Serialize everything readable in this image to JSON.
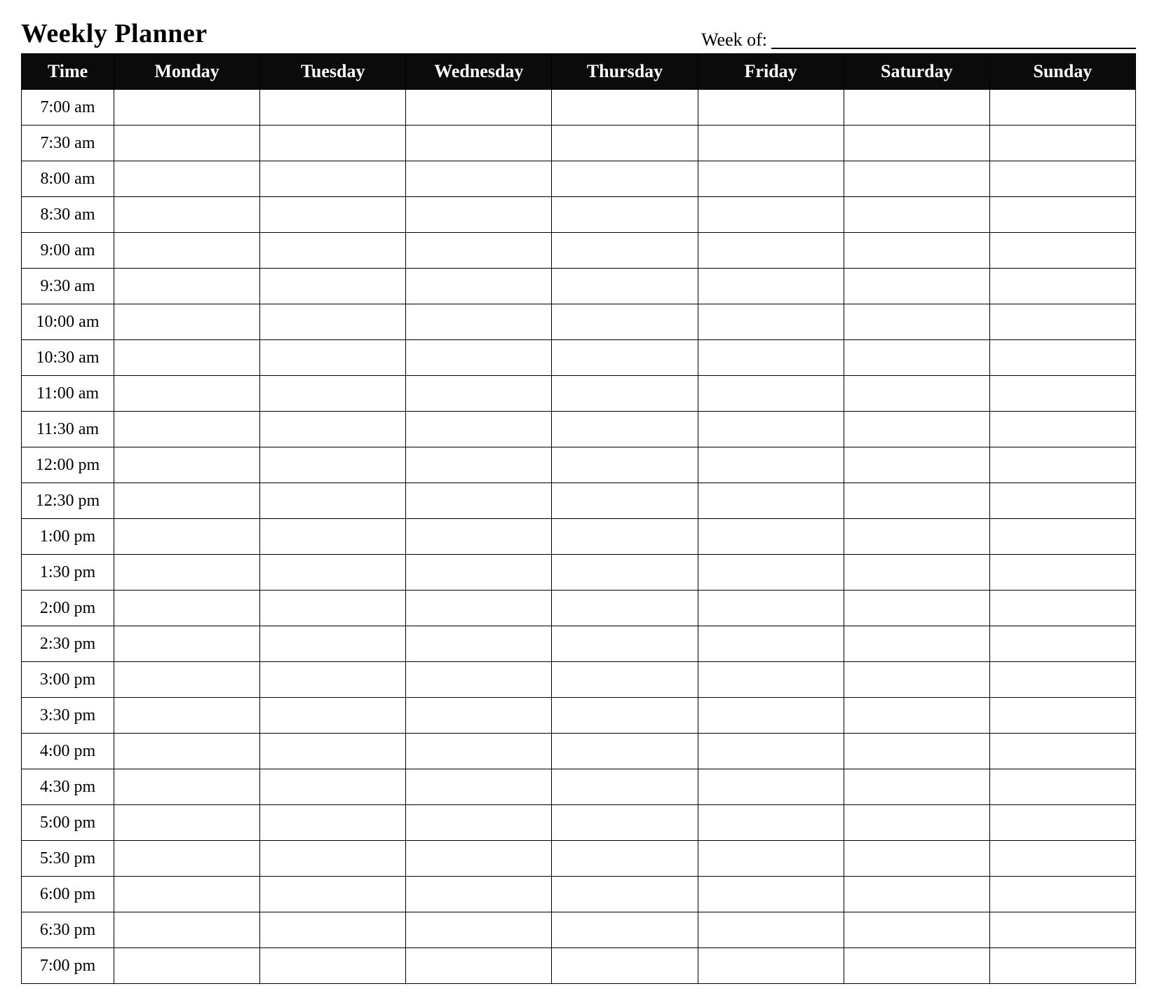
{
  "header": {
    "title": "Weekly Planner",
    "week_of_label": "Week of:",
    "week_of_value": ""
  },
  "columns": [
    "Time",
    "Monday",
    "Tuesday",
    "Wednesday",
    "Thursday",
    "Friday",
    "Saturday",
    "Sunday"
  ],
  "times": [
    "7:00 am",
    "7:30 am",
    "8:00 am",
    "8:30 am",
    "9:00 am",
    "9:30 am",
    "10:00 am",
    "10:30 am",
    "11:00 am",
    "11:30 am",
    "12:00 pm",
    "12:30 pm",
    "1:00 pm",
    "1:30 pm",
    "2:00 pm",
    "2:30 pm",
    "3:00 pm",
    "3:30 pm",
    "4:00 pm",
    "4:30 pm",
    "5:00 pm",
    "5:30 pm",
    "6:00 pm",
    "6:30 pm",
    "7:00 pm"
  ]
}
